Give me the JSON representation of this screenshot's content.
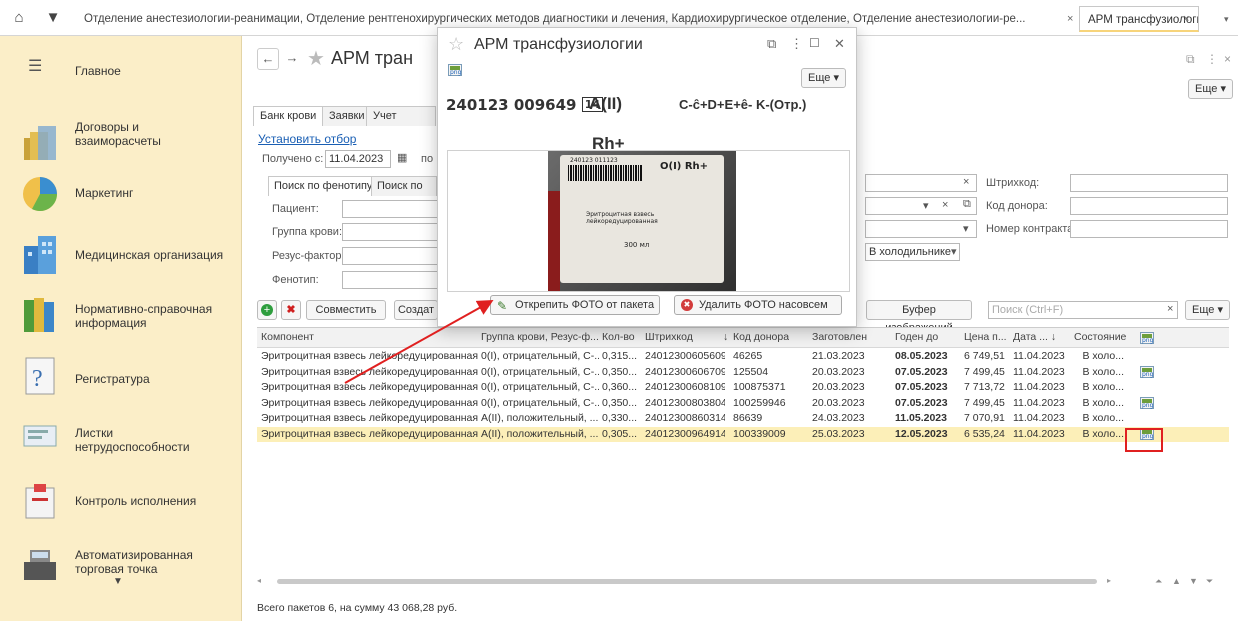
{
  "topbar": {
    "tab1": "Отделение анестезиологии-реанимации, Отделение рентгенохирургических методов диагностики и лечения, Кардиохирургическое отделение, Отделение анестезиологии-ре...",
    "tab1_close": "×",
    "tab2": "АРМ трансфузиологии",
    "tab2_close": "×"
  },
  "sidebar": {
    "items": [
      {
        "label": "Главное"
      },
      {
        "label": "Договоры и\nвзаиморасчеты"
      },
      {
        "label": "Маркетинг"
      },
      {
        "label": "Медицинская организация"
      },
      {
        "label": "Нормативно-справочная\nинформация"
      },
      {
        "label": "Регистратура"
      },
      {
        "label": "Листки\nнетрудоспособности"
      },
      {
        "label": "Контроль исполнения"
      },
      {
        "label": "Автоматизированная\nторговая точка"
      }
    ]
  },
  "form": {
    "title": "АРМ тран",
    "more": "Еще ▾",
    "tabs": [
      "Банк крови",
      "Заявки",
      "Учет движен"
    ],
    "set_filter": "Установить отбор",
    "received_from_label": "Получено с:",
    "received_from_value": "11.04.2023",
    "received_to_label": "по",
    "subtabs": [
      "Поиск по фенотипу",
      "Поиск по ан"
    ],
    "patient_label": "Пациент:",
    "blood_group_label": "Группа крови:",
    "rhesus_label": "Резус-фактор:",
    "phenotype_label": "Фенотип:",
    "barcode_label": "Штрихкод:",
    "donor_code_label": "Код донора:",
    "contract_label": "Номер контракта:",
    "storage_value": "В холодильнике",
    "btn_combine": "Совместить",
    "btn_create": "Создат",
    "btn_image_buffer": "Буфер изображений",
    "search_placeholder": "Поиск (Ctrl+F)",
    "btn_more2": "Еще ▾",
    "footer": "Всего пакетов 6, на сумму 43 068,28 руб."
  },
  "table": {
    "headers": [
      "Компонент",
      "Группа крови, Резус-ф...",
      "Кол-во",
      "Штрихкод",
      "↓",
      "Код донора",
      "Заготовлен",
      "Годен до",
      "Цена п...",
      "Дата ... ↓",
      "Состояние"
    ],
    "rows": [
      {
        "component": "Эритроцитная взвесь лейкоредуцированная",
        "group": "0(I), отрицательный, С-...",
        "qty": "0,315...",
        "barcode": "24012300605609",
        "donor": "46265",
        "prepared": "21.03.2023",
        "valid": "08.05.2023",
        "price": "6 749,51",
        "date": "11.04.2023",
        "state": "В холо...",
        "png": false
      },
      {
        "component": "Эритроцитная взвесь лейкоредуцированная",
        "group": "0(I), отрицательный, С-...",
        "qty": "0,350...",
        "barcode": "24012300606709",
        "donor": "125504",
        "prepared": "20.03.2023",
        "valid": "07.05.2023",
        "price": "7 499,45",
        "date": "11.04.2023",
        "state": "В холо...",
        "png": true
      },
      {
        "component": "Эритроцитная взвесь лейкоредуцированная",
        "group": "0(I), отрицательный, С-...",
        "qty": "0,360...",
        "barcode": "24012300608109",
        "donor": "100875371",
        "prepared": "20.03.2023",
        "valid": "07.05.2023",
        "price": "7 713,72",
        "date": "11.04.2023",
        "state": "В холо...",
        "png": false
      },
      {
        "component": "Эритроцитная взвесь лейкоредуцированная",
        "group": "0(I), отрицательный, С-...",
        "qty": "0,350...",
        "barcode": "24012300803804",
        "donor": "100259946",
        "prepared": "20.03.2023",
        "valid": "07.05.2023",
        "price": "7 499,45",
        "date": "11.04.2023",
        "state": "В холо...",
        "png": true
      },
      {
        "component": "Эритроцитная взвесь лейкоредуцированная",
        "group": "А(II), положительный, ...",
        "qty": "0,330...",
        "barcode": "24012300860314",
        "donor": "86639",
        "prepared": "24.03.2023",
        "valid": "11.05.2023",
        "price": "7 070,91",
        "date": "11.04.2023",
        "state": "В холо...",
        "png": false
      },
      {
        "component": "Эритроцитная взвесь лейкоредуцированная",
        "group": "А(II), положительный, ...",
        "qty": "0,305...",
        "barcode": "24012300964914",
        "donor": "100339009",
        "prepared": "25.03.2023",
        "valid": "12.05.2023",
        "price": "6 535,24",
        "date": "11.04.2023",
        "state": "В холо...",
        "png": true
      }
    ]
  },
  "popup": {
    "title": "АРМ трансфузиологии",
    "more": "Еще ▾",
    "code": "240123 009649",
    "code_box": "14",
    "group": "A(II)",
    "rh": "Rh+",
    "phenotype": "C-ĉ+D+E+ê- K-(Отр.)",
    "photo_text_code": "240123 011123",
    "photo_text_group": "O(I) Rh+",
    "photo_text_name": "Эритроцитная взвесь лейкоредуцированная",
    "photo_text_volume": "300 мл",
    "btn_detach": "Открепить ФОТО от пакета",
    "btn_delete": "Удалить ФОТО насовсем"
  }
}
